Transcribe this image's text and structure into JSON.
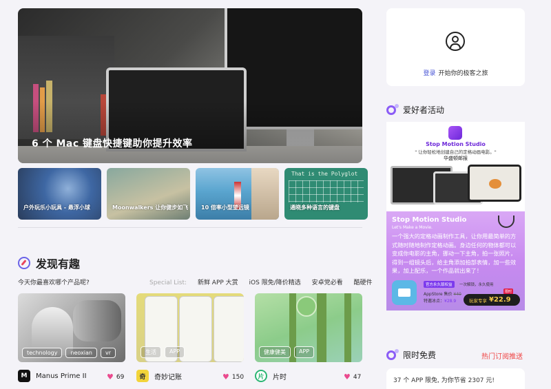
{
  "hero": {
    "title": "6 个 Mac 键盘快捷键助你提升效率"
  },
  "thumbs": [
    {
      "caption": "户外玩乐小玩具 - 悬浮小球"
    },
    {
      "caption": "Moonwalkers 让你健步如飞"
    },
    {
      "caption": "10 倍率小型望远镜"
    },
    {
      "caption": "通晓多种语言的键盘",
      "overlay": "That is the Polyglot"
    }
  ],
  "discover": {
    "title": "发现有趣",
    "question": "今天你最喜欢哪个产品呢?",
    "special_label": "Special List:",
    "links": [
      "新鲜 APP 大赏",
      "iOS 限免/降价精选",
      "安卓党必看",
      "酷硬件"
    ]
  },
  "cards": [
    {
      "tags": [
        "technology",
        "neoxian",
        "vr"
      ],
      "name": "Manus Prime II",
      "likes": "69",
      "icon_text": "M"
    },
    {
      "tags": [
        "生活",
        "APP"
      ],
      "name": "奇妙记账",
      "likes": "150",
      "icon_text": "奇"
    },
    {
      "tags": [
        "健康健美",
        "APP"
      ],
      "name": "片时",
      "likes": "47",
      "icon_text": "片"
    }
  ],
  "sidebar": {
    "login_link": "登录",
    "login_text": "开始你的极客之旅",
    "activity_title": "爱好者活动",
    "promo": {
      "app_name": "Stop Motion Studio",
      "quote": "\" 让你轻松地创建自己的定格动画电影。\"",
      "source": "华盛顿邮报",
      "title": "Stop Motion Studio",
      "subtitle": "Let's Make a Movie.",
      "description": "一个强大的定格动画制作工具，让你用最简单的方式随时随地制作定格动画。身边任何的物体都可以变成你电影的主角，挪动一下主角，拍一张照片，得到一组镜头后，给主角添加拍部表情，加一些效果，加上配乐，一个作品就出来了！",
      "badge": "官方永久版权益",
      "badge_note": "一次解锁，永久使用",
      "store_label": "AppStore 售价",
      "store_price": "¥40",
      "special_label": "特邀冰点：",
      "special_price": "¥28.9",
      "btn_label": "玩家专享",
      "btn_price": "¥22.9",
      "limit_tag": "限时"
    },
    "free_title": "限时免费",
    "free_link": "热门订阅推送",
    "free_text": "37 个 APP 限免, 为你节省 2307 元!"
  }
}
